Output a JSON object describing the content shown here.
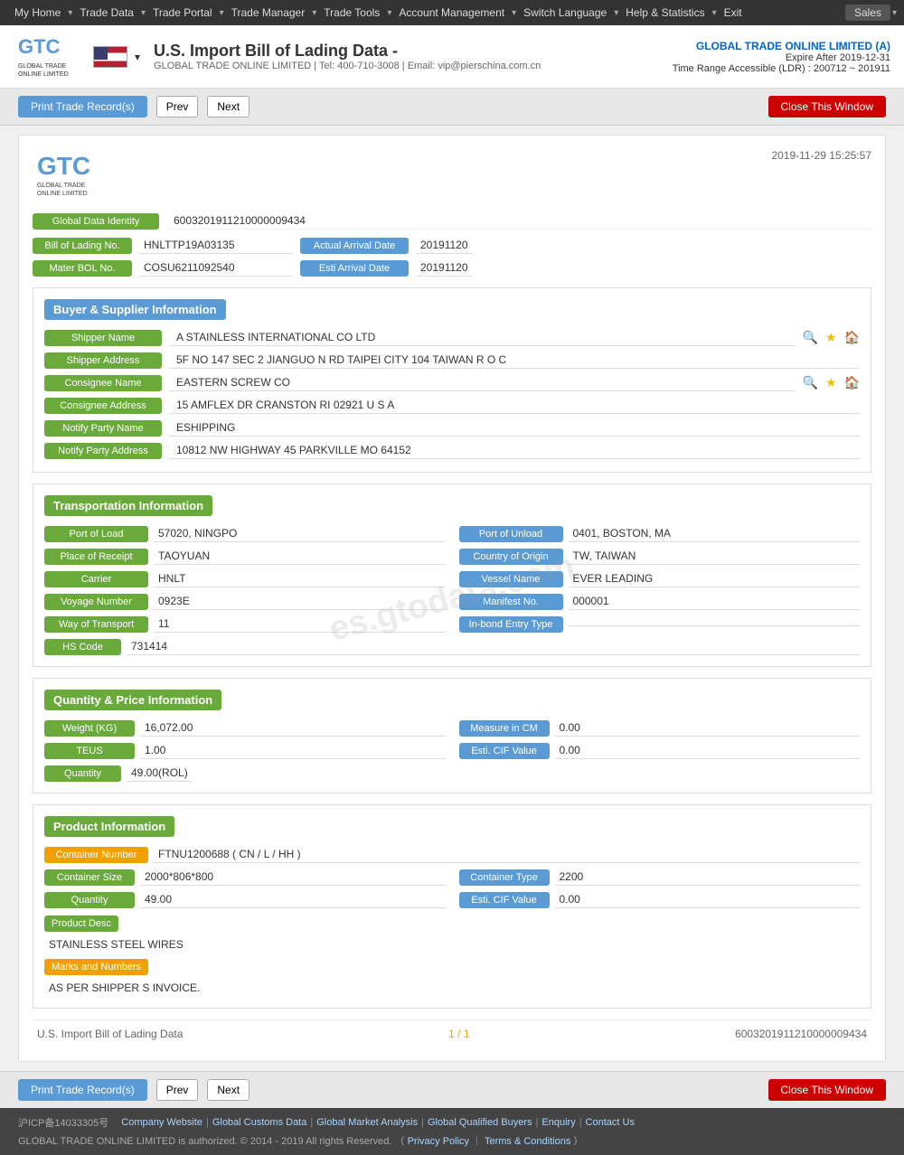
{
  "nav": {
    "items": [
      {
        "label": "My Home",
        "id": "my-home"
      },
      {
        "label": "Trade Data",
        "id": "trade-data"
      },
      {
        "label": "Trade Portal",
        "id": "trade-portal"
      },
      {
        "label": "Trade Manager",
        "id": "trade-manager"
      },
      {
        "label": "Trade Tools",
        "id": "trade-tools"
      },
      {
        "label": "Account Management",
        "id": "account-mgmt"
      },
      {
        "label": "Switch Language",
        "id": "switch-lang"
      },
      {
        "label": "Help & Statistics",
        "id": "help-stats"
      },
      {
        "label": "Exit",
        "id": "exit"
      }
    ],
    "sales_label": "Sales"
  },
  "header": {
    "title": "U.S. Import Bill of Lading Data  -",
    "company": "GLOBAL TRADE ONLINE LIMITED",
    "tel": "Tel: 400-710-3008",
    "email": "Email: vip@pierschina.com.cn",
    "right_company": "GLOBAL TRADE ONLINE LIMITED (A)",
    "expire": "Expire After 2019-12-31",
    "ldr": "Time Range Accessible (LDR) : 200712 ~ 201911"
  },
  "toolbar": {
    "print_label": "Print Trade Record(s)",
    "prev_label": "Prev",
    "next_label": "Next",
    "close_label": "Close This Window"
  },
  "record": {
    "date": "2019-11-29 15:25:57",
    "global_data_identity_label": "Global Data Identity",
    "global_data_identity_value": "6003201911210000009434",
    "bol_no_label": "Bill of Lading No.",
    "bol_no_value": "HNLTTP19A03135",
    "actual_arrival_label": "Actual Arrival Date",
    "actual_arrival_value": "20191120",
    "master_bol_label": "Mater BOL No.",
    "master_bol_value": "COSU6211092540",
    "esti_arrival_label": "Esti Arrival Date",
    "esti_arrival_value": "20191120"
  },
  "buyer_supplier": {
    "section_label": "Buyer & Supplier Information",
    "shipper_name_label": "Shipper Name",
    "shipper_name_value": "A STAINLESS INTERNATIONAL CO LTD",
    "shipper_address_label": "Shipper Address",
    "shipper_address_value": "5F NO 147 SEC 2 JIANGUO N RD TAIPEI CITY 104 TAIWAN R O C",
    "consignee_name_label": "Consignee Name",
    "consignee_name_value": "EASTERN SCREW CO",
    "consignee_address_label": "Consignee Address",
    "consignee_address_value": "15 AMFLEX DR CRANSTON RI 02921 U S A",
    "notify_party_name_label": "Notify Party Name",
    "notify_party_name_value": "ESHIPPING",
    "notify_party_address_label": "Notify Party Address",
    "notify_party_address_value": "10812 NW HIGHWAY 45 PARKVILLE MO 64152"
  },
  "transportation": {
    "section_label": "Transportation Information",
    "port_of_load_label": "Port of Load",
    "port_of_load_value": "57020, NINGPO",
    "port_of_unload_label": "Port of Unload",
    "port_of_unload_value": "0401, BOSTON, MA",
    "place_of_receipt_label": "Place of Receipt",
    "place_of_receipt_value": "TAOYUAN",
    "country_of_origin_label": "Country of Origin",
    "country_of_origin_value": "TW, TAIWAN",
    "carrier_label": "Carrier",
    "carrier_value": "HNLT",
    "vessel_name_label": "Vessel Name",
    "vessel_name_value": "EVER LEADING",
    "voyage_number_label": "Voyage Number",
    "voyage_number_value": "0923E",
    "manifest_no_label": "Manifest No.",
    "manifest_no_value": "000001",
    "way_of_transport_label": "Way of Transport",
    "way_of_transport_value": "11",
    "in_bond_label": "In-bond Entry Type",
    "in_bond_value": "",
    "hs_code_label": "HS Code",
    "hs_code_value": "731414"
  },
  "quantity_price": {
    "section_label": "Quantity & Price Information",
    "weight_label": "Weight (KG)",
    "weight_value": "16,072.00",
    "measure_label": "Measure in CM",
    "measure_value": "0.00",
    "teus_label": "TEUS",
    "teus_value": "1.00",
    "esti_cif_label": "Esti. CIF Value",
    "esti_cif_value": "0.00",
    "quantity_label": "Quantity",
    "quantity_value": "49.00(ROL)"
  },
  "product": {
    "section_label": "Product Information",
    "container_number_label": "Container Number",
    "container_number_value": "FTNU1200688 ( CN / L / HH )",
    "container_size_label": "Container Size",
    "container_size_value": "2000*806*800",
    "container_type_label": "Container Type",
    "container_type_value": "2200",
    "quantity_label": "Quantity",
    "quantity_value": "49.00",
    "esti_cif_label": "Esti. CIF Value",
    "esti_cif_value": "0.00",
    "product_desc_label": "Product Desc",
    "product_desc_value": "STAINLESS STEEL WIRES",
    "marks_label": "Marks and Numbers",
    "marks_value": "AS PER SHIPPER S INVOICE."
  },
  "record_footer": {
    "left": "U.S. Import Bill of Lading Data",
    "middle": "1 / 1",
    "right": "6003201911210000009434"
  },
  "footer": {
    "icp": "沪ICP备14033305号",
    "links": [
      "Company Website",
      "Global Customs Data",
      "Global Market Analysis",
      "Global Qualified Buyers",
      "Enquiry",
      "Contact Us"
    ],
    "copyright": "GLOBAL TRADE ONLINE LIMITED is authorized. © 2014 - 2019 All rights Reserved.  （",
    "privacy": "Privacy Policy",
    "separator": "｜",
    "terms": "Terms & Conditions",
    "close_paren": "）"
  },
  "watermark": "es.gtodata.com"
}
